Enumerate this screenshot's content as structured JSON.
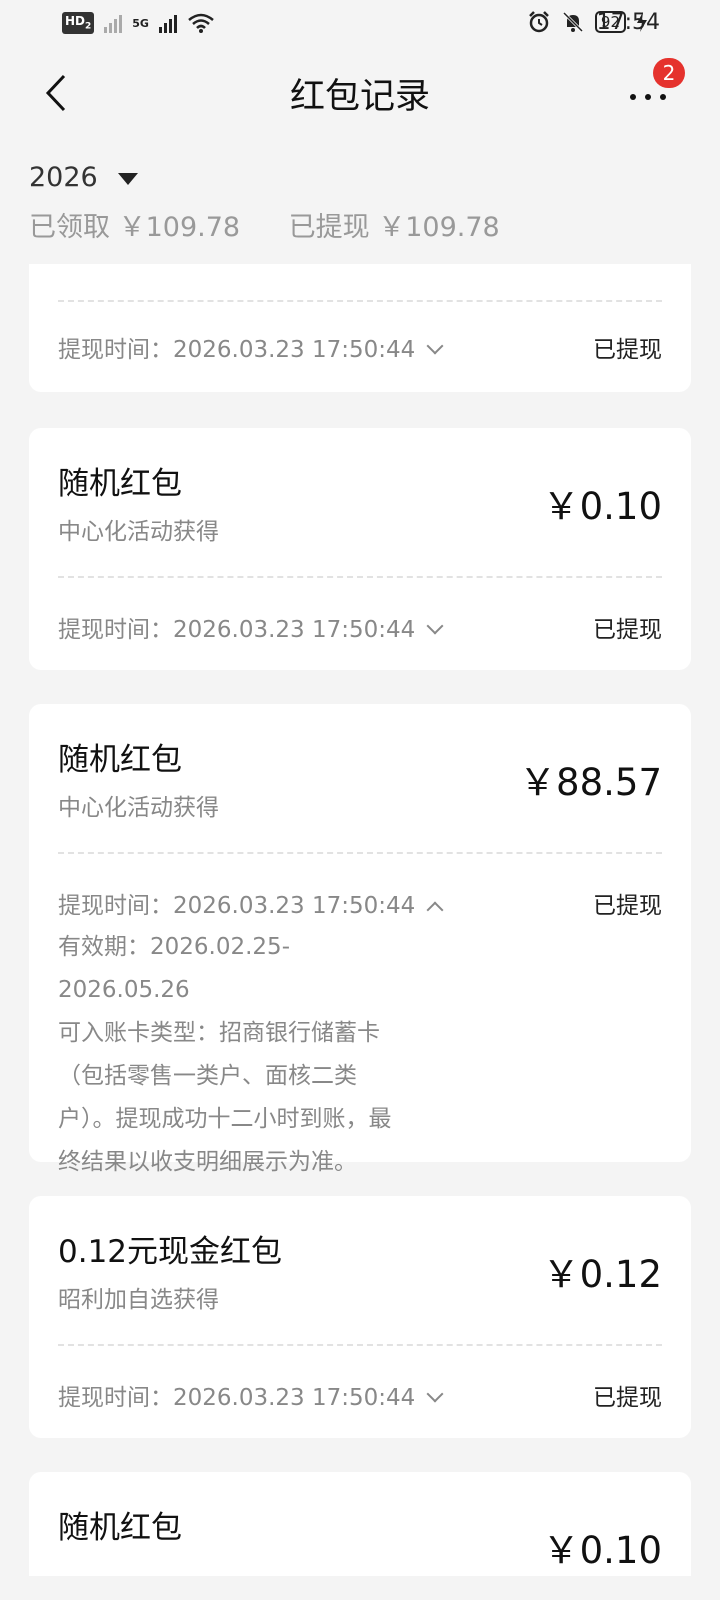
{
  "status_bar": {
    "network_badge": "HD",
    "sim2": "2",
    "net_type": "5G",
    "battery": "92",
    "time": "17:54"
  },
  "header": {
    "title": "红包记录",
    "more_badge": "2"
  },
  "summary": {
    "year": "2026",
    "received": "已领取 ￥109.78",
    "withdrawn": "已提现 ￥109.78"
  },
  "records": [
    {
      "time_label": "提现时间：2026.03.23 17:50:44",
      "state": "已提现"
    },
    {
      "name": "随机红包",
      "source": "中心化活动获得",
      "amount": "￥0.10",
      "time_label": "提现时间：2026.03.23 17:50:44",
      "state": "已提现"
    },
    {
      "name": "随机红包",
      "source": "中心化活动获得",
      "amount": "￥88.57",
      "time_label": "提现时间：2026.03.23 17:50:44",
      "state": "已提现",
      "detail_lines": [
        "有效期：2026.02.25-2026.05.26",
        "可入账卡类型：招商银行储蓄卡",
        "（包括零售一类户、面核二类",
        "户）。提现成功十二小时到账，最",
        "终结果以收支明细展示为准。"
      ]
    },
    {
      "name": "0.12元现金红包",
      "source": "昭利加自选获得",
      "amount": "￥0.12",
      "time_label": "提现时间：2026.03.23 17:50:44",
      "state": "已提现"
    },
    {
      "name": "随机红包",
      "amount": "￥0.10"
    }
  ]
}
